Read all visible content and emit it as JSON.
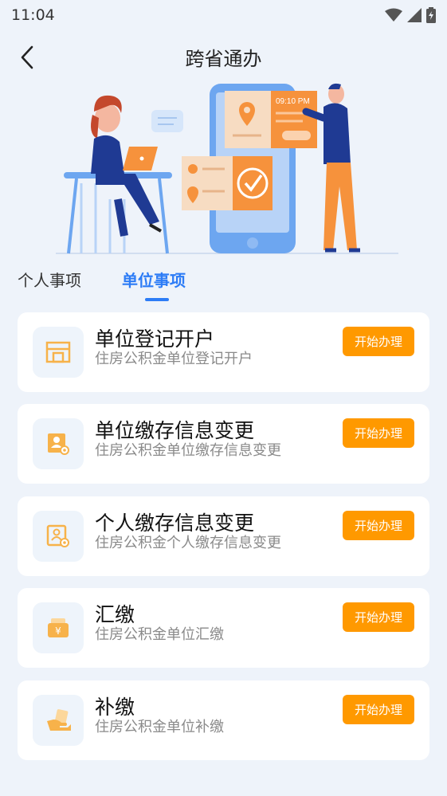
{
  "status": {
    "time": "11:04",
    "icons": [
      "wifi-icon",
      "signal-icon",
      "battery-icon"
    ]
  },
  "header": {
    "title": "跨省通办",
    "back_icon": "chevron-left-icon"
  },
  "hero": {
    "clock_text": "09:10 PM"
  },
  "tabs": [
    {
      "label": "个人事项",
      "active": false
    },
    {
      "label": "单位事项",
      "active": true
    }
  ],
  "colors": {
    "accent": "#2d7cf6",
    "button": "#ff9900",
    "icon_orange": "#f7b24a",
    "background": "#eef3fa"
  },
  "items": [
    {
      "title": "单位登记开户",
      "desc": "住房公积金单位登记开户",
      "button": "开始办理",
      "icon": "storefront-icon"
    },
    {
      "title": "单位缴存信息变更",
      "desc": "住房公积金单位缴存信息变更",
      "button": "开始办理",
      "icon": "profile-settings-icon"
    },
    {
      "title": "个人缴存信息变更",
      "desc": "住房公积金个人缴存信息变更",
      "button": "开始办理",
      "icon": "profile-settings-icon"
    },
    {
      "title": "汇缴",
      "desc": "住房公积金单位汇缴",
      "button": "开始办理",
      "icon": "wallet-yuan-icon"
    },
    {
      "title": "补缴",
      "desc": "住房公积金单位补缴",
      "button": "开始办理",
      "icon": "hand-payment-icon"
    }
  ]
}
